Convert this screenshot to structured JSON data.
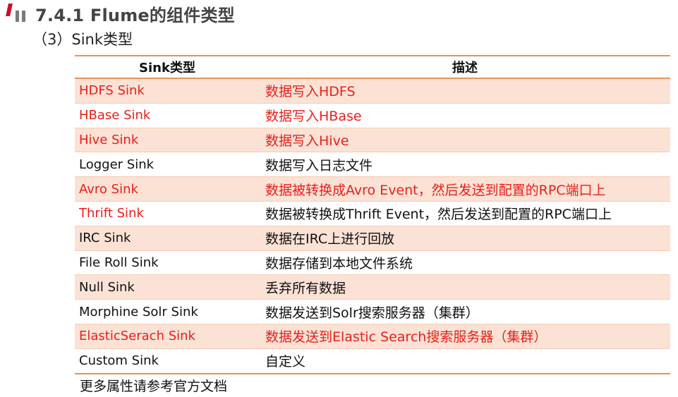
{
  "page": {
    "title": "7.4.1 Flume的组件类型",
    "subtitle": "（3）Sink类型",
    "footer": "更多属性请参考官方文档"
  },
  "colors": {
    "accent_red": "#c8102e",
    "highlight_text": "#e8201a",
    "border_orange": "#e4935a",
    "row_shade": "#fbe2d5"
  },
  "table": {
    "headers": [
      "Sink类型",
      "描述"
    ],
    "rows": [
      {
        "type": "HDFS Sink",
        "desc": "数据写入HDFS",
        "highlight": true
      },
      {
        "type": "HBase Sink",
        "desc": "数据写入HBase",
        "highlight": true
      },
      {
        "type": "Hive Sink",
        "desc": "数据写入Hive",
        "highlight": true
      },
      {
        "type": "Logger Sink",
        "desc": "数据写入日志文件",
        "highlight": false
      },
      {
        "type": "Avro Sink",
        "desc": "数据被转换成Avro Event，然后发送到配置的RPC端口上",
        "highlight": true
      },
      {
        "type": "Thrift Sink",
        "desc": "数据被转换成Thrift Event，然后发送到配置的RPC端口上",
        "highlight": "partial"
      },
      {
        "type": "IRC Sink",
        "desc": "数据在IRC上进行回放",
        "highlight": false
      },
      {
        "type": "File Roll Sink",
        "desc": "数据存储到本地文件系统",
        "highlight": false
      },
      {
        "type": "Null Sink",
        "desc": "丢弃所有数据",
        "highlight": false
      },
      {
        "type": "Morphine Solr Sink",
        "desc": "数据发送到Solr搜索服务器（集群）",
        "highlight": false
      },
      {
        "type": "ElasticSerach Sink",
        "desc": "数据发送到Elastic Search搜索服务器（集群）",
        "highlight": true
      },
      {
        "type": "Custom Sink",
        "desc": "自定义",
        "highlight": false
      }
    ]
  }
}
